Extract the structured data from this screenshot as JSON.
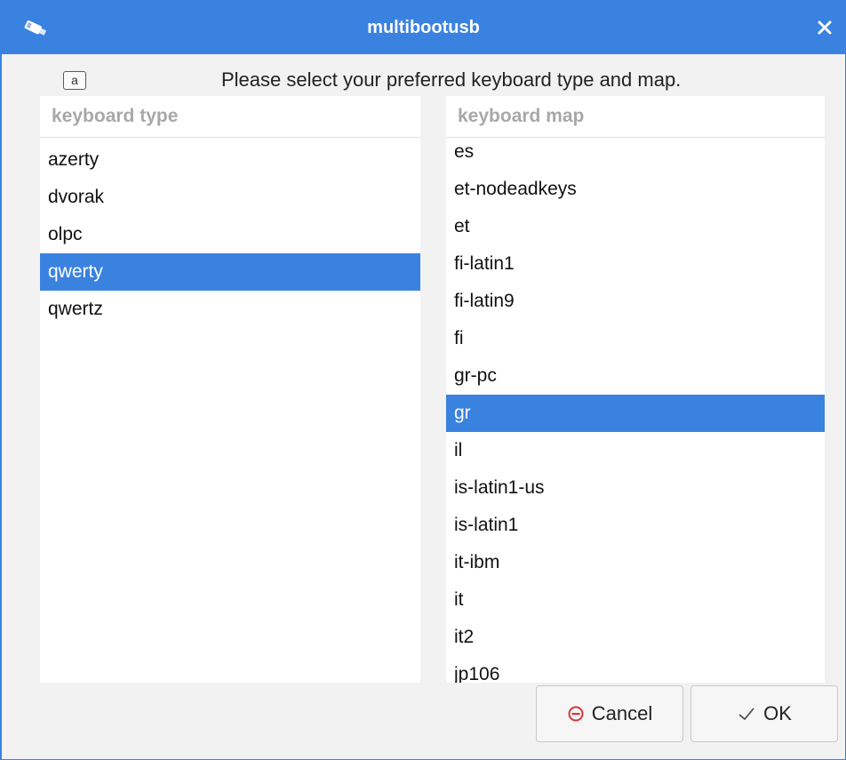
{
  "window": {
    "title": "multibootusb"
  },
  "header": {
    "key_icon_label": "a",
    "prompt": "Please select your preferred keyboard type and map."
  },
  "keyboard_type": {
    "header": "keyboard type",
    "items": [
      "azerty",
      "dvorak",
      "olpc",
      "qwerty",
      "qwertz"
    ],
    "selected": "qwerty"
  },
  "keyboard_map": {
    "header": "keyboard map",
    "items": [
      "es",
      "et-nodeadkeys",
      "et",
      "fi-latin1",
      "fi-latin9",
      "fi",
      "gr-pc",
      "gr",
      "il",
      "is-latin1-us",
      "is-latin1",
      "it-ibm",
      "it",
      "it2",
      "jp106"
    ],
    "selected": "gr"
  },
  "buttons": {
    "cancel": "Cancel",
    "ok": "OK"
  },
  "colors": {
    "accent": "#3a82e0",
    "cancel_icon": "#d9343e"
  }
}
